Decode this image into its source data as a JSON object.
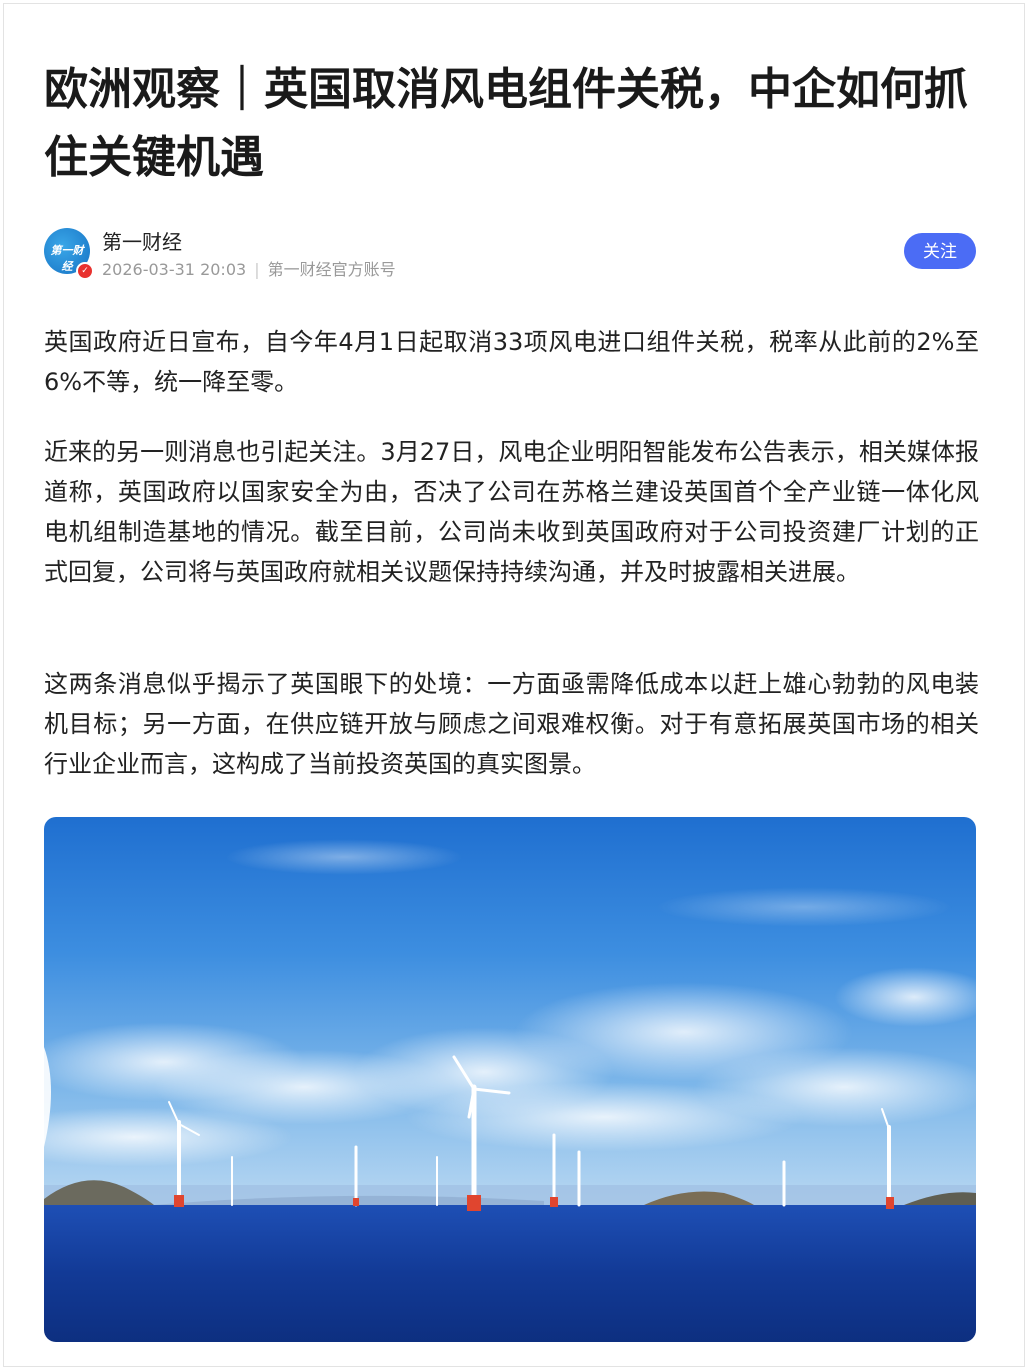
{
  "article": {
    "title": "欧洲观察｜英国取消风电组件关税，中企如何抓住关键机遇",
    "author": {
      "name": "第一财经",
      "avatar_text": "第一财经",
      "published": "2026-03-31 20:03",
      "account_type": "第一财经官方账号"
    },
    "follow_label": "关注",
    "paragraphs": [
      "英国政府近日宣布，自今年4月1日起取消33项风电进口组件关税，税率从此前的2%至6%不等，统一降至零。",
      "近来的另一则消息也引起关注。3月27日，风电企业明阳智能发布公告表示，相关媒体报道称，英国政府以国家安全为由，否决了公司在苏格兰建设英国首个全产业链一体化风电机组制造基地的情况。截至目前，公司尚未收到英国政府对于公司投资建厂计划的正式回复，公司将与英国政府就相关议题保持持续沟通，并及时披露相关进展。",
      "这两条消息似乎揭示了英国眼下的处境：一方面亟需降低成本以赶上雄心勃勃的风电装机目标；另一方面，在供应链开放与顾虑之间艰难权衡。对于有意拓展英国市场的相关行业企业而言，这构成了当前投资英国的真实图景。"
    ]
  },
  "colors": {
    "follow_button": "#4b6cf5",
    "title_text": "#1a1a1a",
    "meta_text": "#999999",
    "verified_badge": "#e8322f"
  },
  "icons": {
    "verified": "verified-badge-icon"
  }
}
